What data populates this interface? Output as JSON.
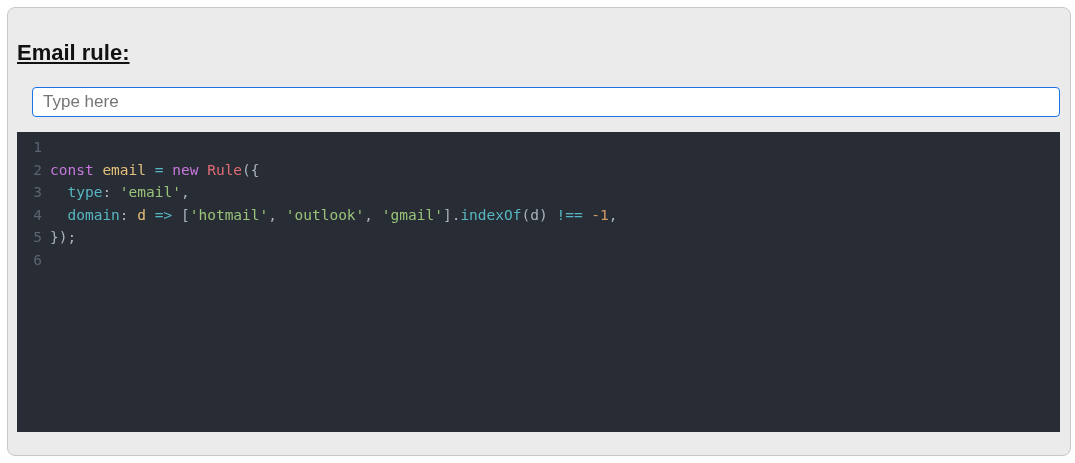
{
  "heading": "Email rule:",
  "input": {
    "placeholder": "Type here"
  },
  "code": {
    "lines": [
      {
        "number": "1"
      },
      {
        "number": "2",
        "tokens": [
          {
            "kind": "keyword",
            "text": "const "
          },
          {
            "kind": "variable",
            "text": "email "
          },
          {
            "kind": "operator",
            "text": "= "
          },
          {
            "kind": "keyword",
            "text": "new "
          },
          {
            "kind": "class",
            "text": "Rule"
          },
          {
            "kind": "punct",
            "text": "({"
          }
        ]
      },
      {
        "number": "3",
        "tokens": [
          {
            "kind": "property",
            "text": "  type"
          },
          {
            "kind": "punct",
            "text": ": "
          },
          {
            "kind": "string",
            "text": "'email'"
          },
          {
            "kind": "punct",
            "text": ","
          }
        ]
      },
      {
        "number": "4",
        "tokens": [
          {
            "kind": "property",
            "text": "  domain"
          },
          {
            "kind": "punct",
            "text": ": "
          },
          {
            "kind": "variable",
            "text": "d "
          },
          {
            "kind": "operator",
            "text": "=> "
          },
          {
            "kind": "punct",
            "text": "["
          },
          {
            "kind": "string",
            "text": "'hotmail'"
          },
          {
            "kind": "punct",
            "text": ", "
          },
          {
            "kind": "string",
            "text": "'outlook'"
          },
          {
            "kind": "punct",
            "text": ", "
          },
          {
            "kind": "string",
            "text": "'gmail'"
          },
          {
            "kind": "punct",
            "text": "]."
          },
          {
            "kind": "function",
            "text": "indexOf"
          },
          {
            "kind": "punct",
            "text": "(d) "
          },
          {
            "kind": "operator",
            "text": "!== "
          },
          {
            "kind": "number",
            "text": "-1"
          },
          {
            "kind": "punct",
            "text": ","
          }
        ]
      },
      {
        "number": "5",
        "tokens": [
          {
            "kind": "punct",
            "text": "});"
          }
        ]
      },
      {
        "number": "6"
      }
    ]
  }
}
